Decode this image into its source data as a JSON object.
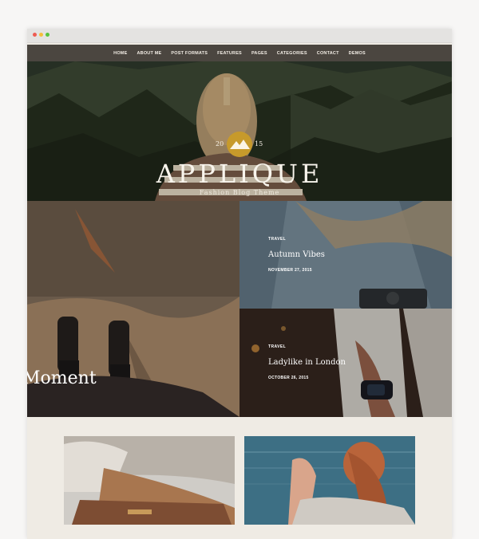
{
  "nav": {
    "items": [
      "HOME",
      "ABOUT ME",
      "POST FORMATS",
      "FEATURES",
      "PAGES",
      "CATEGORIES",
      "CONTACT",
      "DEMOS"
    ]
  },
  "hero": {
    "year_left": "20",
    "year_right": "15",
    "title": "APPLIQUE",
    "tagline": "Fashion Blog Theme"
  },
  "posts": {
    "featured_title": "Moment",
    "post1": {
      "category": "TRAVEL",
      "title": "Autumn Vibes",
      "date": "NOVEMBER 27, 2015"
    },
    "post2": {
      "category": "TRAVEL",
      "title": "Ladylike in London",
      "date": "OCTOBER 26, 2015"
    }
  },
  "colors": {
    "nav_bg": "#4b4640",
    "page_bg": "#efebe4",
    "emblem_gold": "#c79a2b",
    "traffic_red": "#ee5b52",
    "traffic_yellow": "#f4bf3a",
    "traffic_green": "#58c43f"
  }
}
